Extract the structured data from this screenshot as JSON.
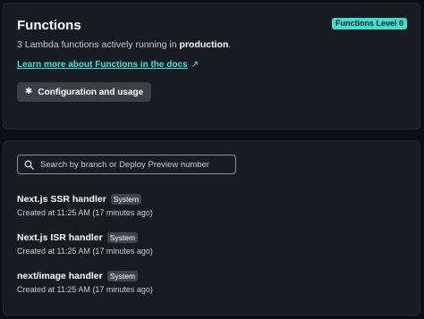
{
  "header": {
    "title": "Functions",
    "level_badge": "Functions Level 0",
    "summary_prefix": "3 Lambda functions actively running in ",
    "summary_env": "production",
    "summary_suffix": ".",
    "docs_link": "Learn more about Functions in the docs",
    "docs_link_icon": "external-arrow-icon",
    "config_button": "Configuration and usage",
    "config_button_icon": "gear-icon"
  },
  "search": {
    "placeholder": "Search by branch or Deploy Preview number",
    "value": "",
    "icon": "search-icon"
  },
  "functions": [
    {
      "name": "Next.js SSR handler",
      "badge": "System",
      "created": "Created at 11:25 AM (17 minutes ago)"
    },
    {
      "name": "Next.js ISR handler",
      "badge": "System",
      "created": "Created at 11:25 AM (17 minutes ago)"
    },
    {
      "name": "next/image handler",
      "badge": "System",
      "created": "Created at 11:25 AM (17 minutes ago)"
    }
  ],
  "colors": {
    "accent": "#40e0d0",
    "link": "#32e6e2",
    "background": "#0c1015",
    "card": "#181b20"
  }
}
